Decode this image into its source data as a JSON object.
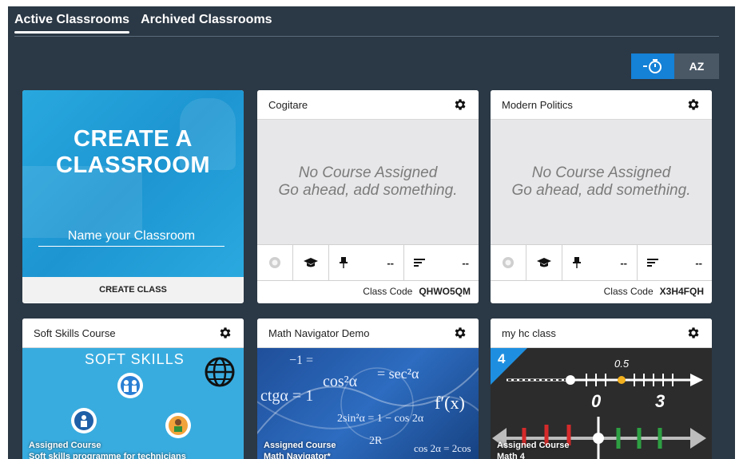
{
  "tabs": [
    {
      "label": "Active Classrooms"
    },
    {
      "label": "Archived Classrooms"
    }
  ],
  "sort": {
    "recent_label": "-⏱",
    "az_label": "AZ"
  },
  "create_card": {
    "title_line1": "CREATE A",
    "title_line2": "CLASSROOM",
    "name_placeholder": "Name your Classroom",
    "button_label": "CREATE CLASS"
  },
  "classes": [
    {
      "name": "Cogitare",
      "empty_line1": "No Course Assigned",
      "empty_line2": "Go ahead, add something.",
      "stat_pinned": "--",
      "stat_sort": "--",
      "code_label": "Class Code",
      "code": "QHWO5QM"
    },
    {
      "name": "Modern Politics",
      "empty_line1": "No Course Assigned",
      "empty_line2": "Go ahead, add something.",
      "stat_pinned": "--",
      "stat_sort": "--",
      "code_label": "Class Code",
      "code": "X3H4FQH"
    }
  ],
  "image_classes": [
    {
      "name": "Soft Skills Course",
      "image_text": "SOFT SKILLS",
      "assigned_label": "Assigned Course",
      "course": "Soft skills programme for technicians"
    },
    {
      "name": "Math Navigator Demo",
      "assigned_label": "Assigned Course",
      "course": "Math Navigator*"
    },
    {
      "name": "my hc class",
      "badge": "4",
      "number_line_labels": [
        "0.5",
        "0",
        "3"
      ],
      "assigned_label": "Assigned Course",
      "course": "Math 4"
    }
  ],
  "colors": {
    "background": "#2b3845",
    "accent": "#1581d7",
    "create_blue": "#1d95d1"
  }
}
